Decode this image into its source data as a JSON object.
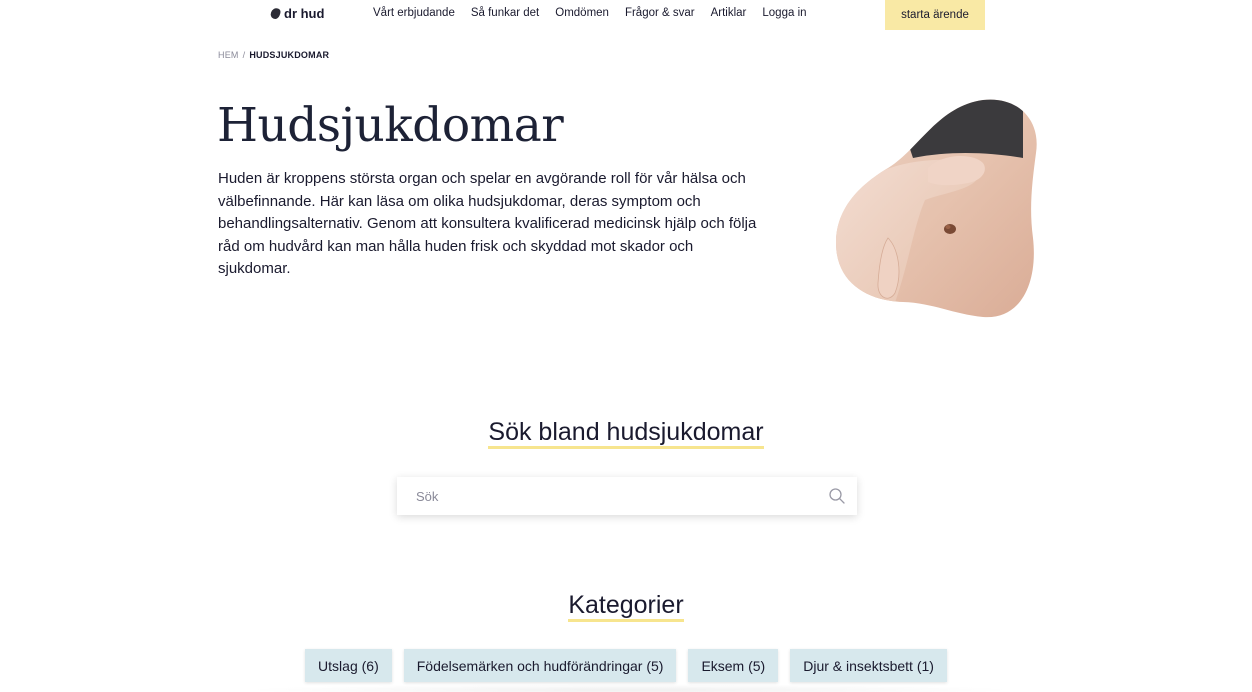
{
  "nav": {
    "logo_text": "dr hud",
    "links": [
      "Vårt erbjudande",
      "Så funkar det",
      "Omdömen",
      "Frågor & svar",
      "Artiklar",
      "Logga in"
    ],
    "cta_label": "starta ärende"
  },
  "breadcrumb": {
    "home": "HEM",
    "separator": "/",
    "current": "HUDSJUKDOMAR"
  },
  "hero": {
    "title": "Hudsjukdomar",
    "text": "Huden är kroppens största organ och spelar en avgörande roll för vår hälsa och välbefinnande. Här kan läsa om olika hudsjukdomar, deras symptom och behandlingsalternativ. Genom att konsultera kvalificerad medicinsk hjälp och följa råd om hudvård kan man hålla huden frisk och skyddad mot skador och sjukdomar."
  },
  "search": {
    "heading": "Sök bland hudsjukdomar",
    "placeholder": "Sök",
    "value": ""
  },
  "categories": {
    "heading": "Kategorier",
    "items": [
      "Utslag (6)",
      "Födelsemärken och hudförändringar (5)",
      "Eksem (5)",
      "Djur & insektsbett (1)"
    ]
  },
  "colors": {
    "cta_bg": "#f9e9a5",
    "heading_underline": "#f5de72",
    "category_bg": "#d7e8ed",
    "text": "#1a1a2e"
  },
  "icons": {
    "logo": "logo-mark-icon",
    "search": "search-icon"
  }
}
